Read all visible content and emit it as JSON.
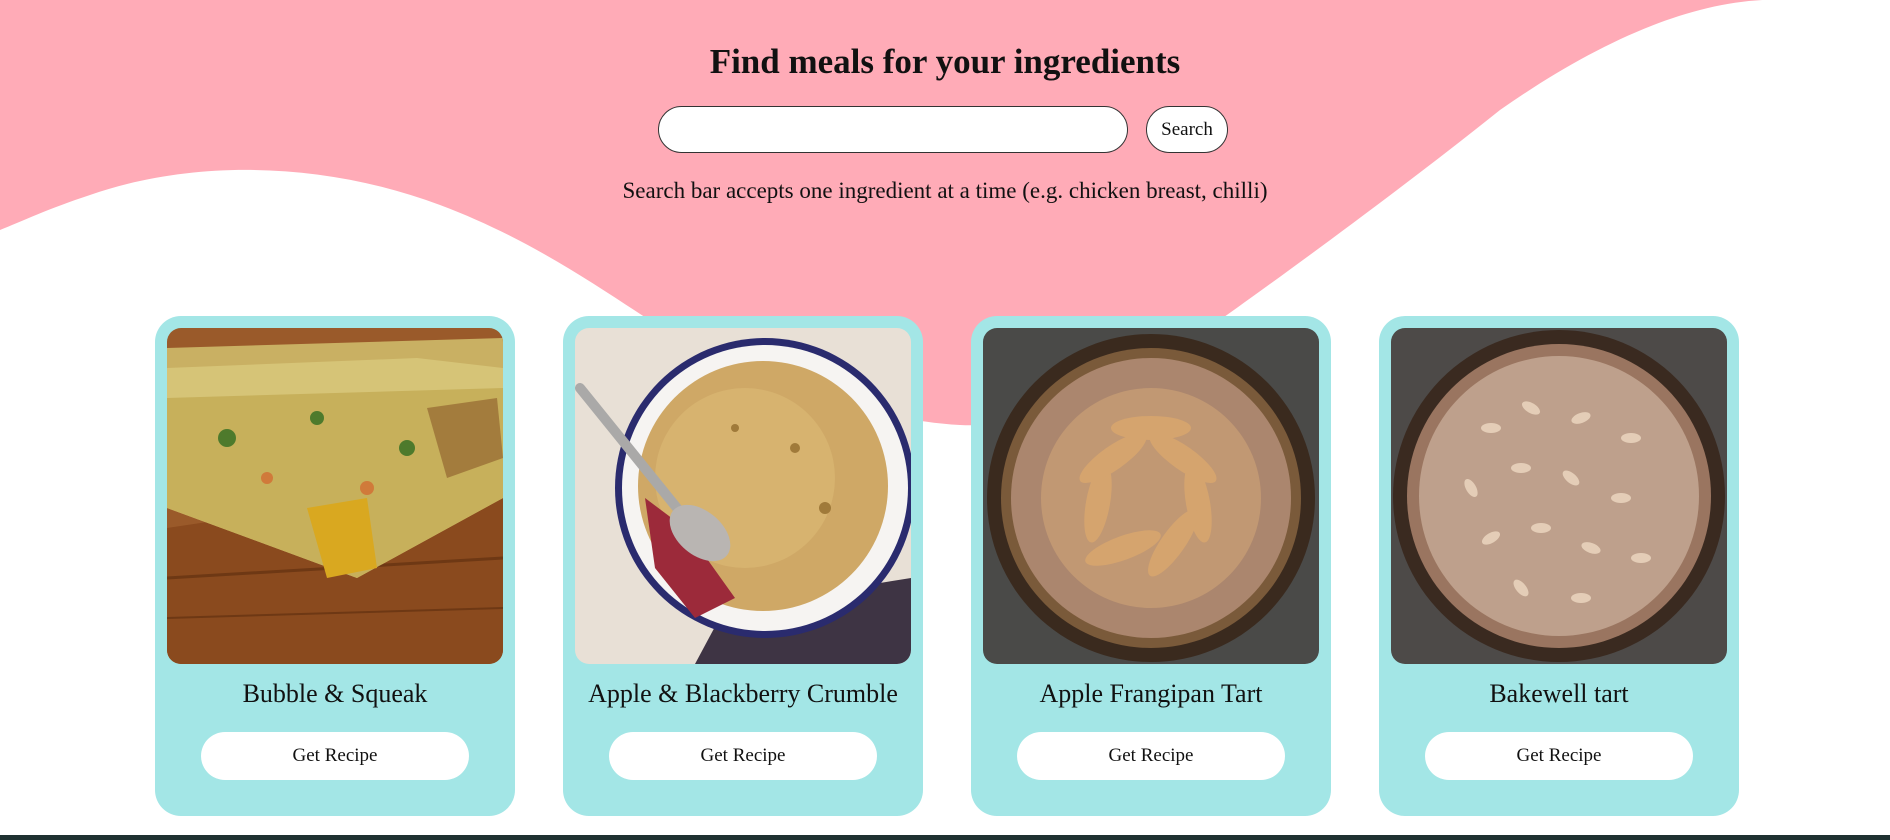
{
  "colors": {
    "hero_pink": "#ffabb7",
    "card_teal": "#a3e6e6",
    "footer_bar": "#1f3131"
  },
  "header": {
    "title": "Find meals for your ingredients",
    "search_placeholder": "",
    "search_value": "",
    "search_button": "Search",
    "hint": "Search bar accepts one ingredient at a time (e.g. chicken breast, chilli)"
  },
  "recipes": [
    {
      "name": "Bubble & Squeak",
      "button": "Get Recipe",
      "image_icon": "bubble-squeak-photo"
    },
    {
      "name": "Apple & Blackberry Crumble",
      "button": "Get Recipe",
      "image_icon": "crumble-photo"
    },
    {
      "name": "Apple Frangipan Tart",
      "button": "Get Recipe",
      "image_icon": "frangipan-tart-photo"
    },
    {
      "name": "Bakewell tart",
      "button": "Get Recipe",
      "image_icon": "bakewell-tart-photo"
    }
  ]
}
